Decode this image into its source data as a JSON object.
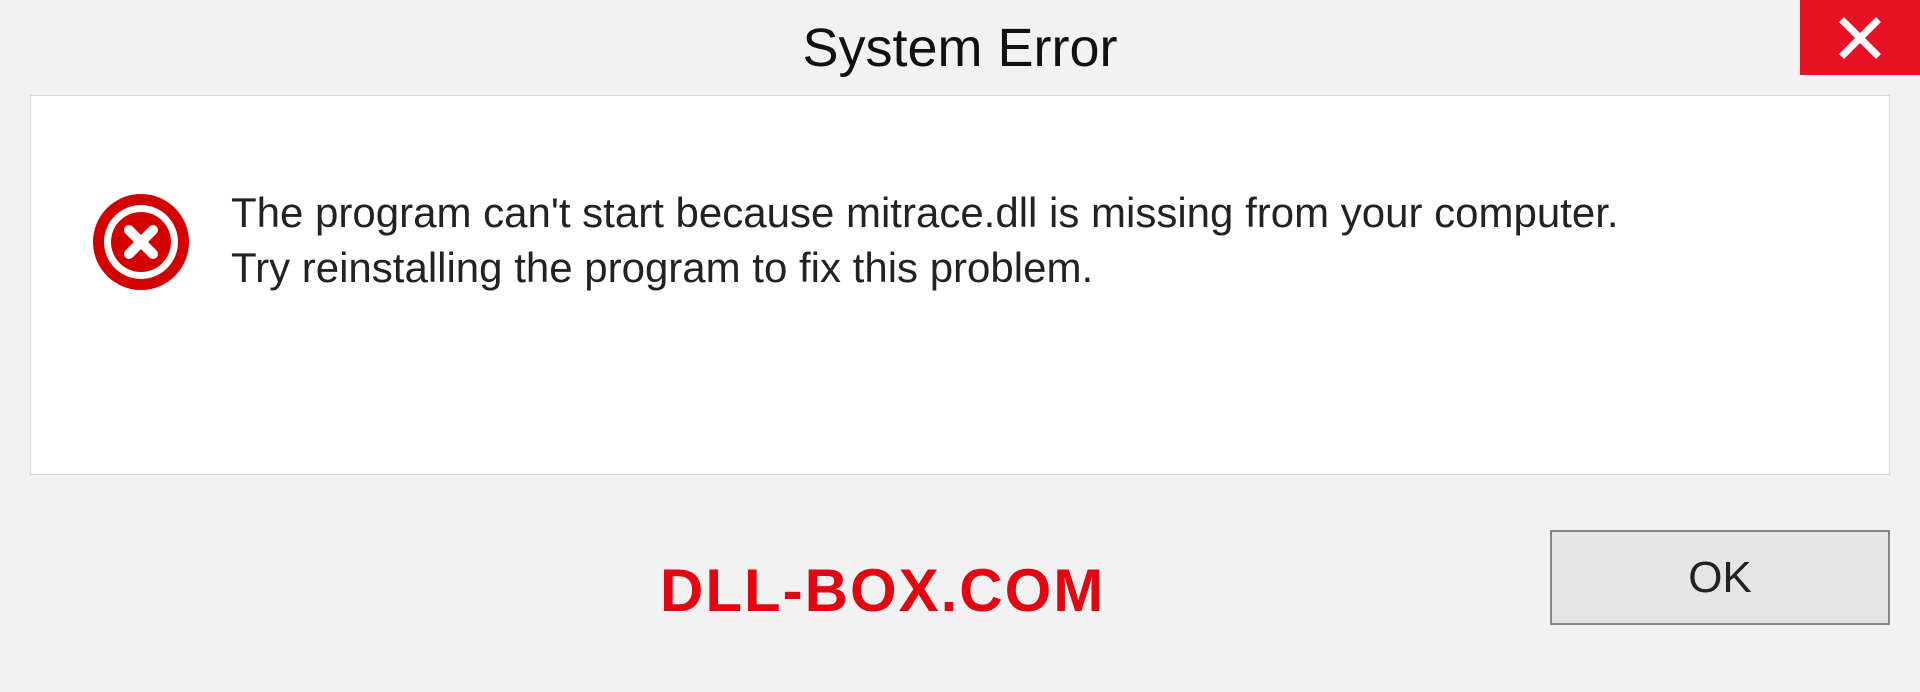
{
  "titlebar": {
    "title": "System Error"
  },
  "message": {
    "line1": "The program can't start because mitrace.dll is missing from your computer.",
    "line2": "Try reinstalling the program to fix this problem."
  },
  "footer": {
    "watermark": "DLL-BOX.COM",
    "ok_label": "OK"
  },
  "colors": {
    "close_bg": "#e81123",
    "error_red": "#d40000",
    "watermark_red": "#e20613"
  }
}
